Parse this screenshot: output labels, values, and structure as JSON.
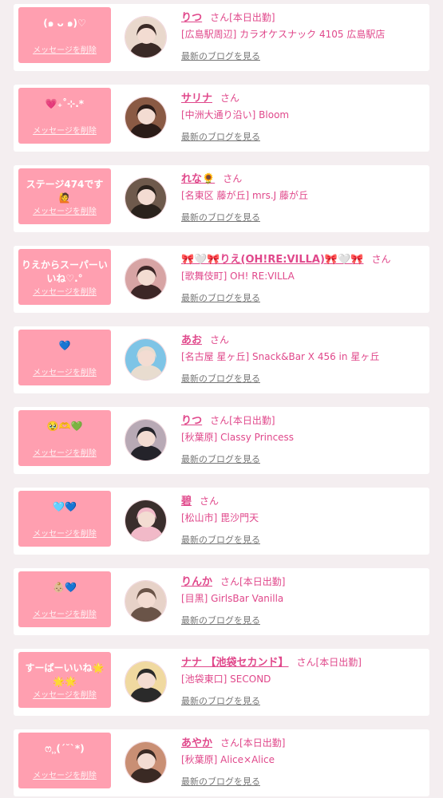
{
  "delete_label": "メッセージを削除",
  "blog_label": "最新のブログを見る",
  "honorific": "さん",
  "items": [
    {
      "message": "(๑ ᴗ ๑)♡",
      "name": "りつ",
      "status": "[本日出勤]",
      "shop": "[広島駅周辺] カラオケスナック 4105 広島駅店",
      "avatar_colors": [
        "#e9d8cc",
        "#3a2a26"
      ]
    },
    {
      "message": "💗₊˚⊹.*",
      "name": "サリナ",
      "status": "",
      "shop": "[中洲大通り沿い] Bloom",
      "avatar_colors": [
        "#8a5a44",
        "#2b1c18"
      ]
    },
    {
      "message": "ステージ474です🙋",
      "name": "れな🌻",
      "status": "",
      "shop": "[名東区 藤が丘] mrs.J 藤が丘",
      "avatar_colors": [
        "#6e5a4c",
        "#2a221c"
      ]
    },
    {
      "message": "りえからスーパーいいね♡.°",
      "name": "🎀🤍🎀りえ(OH!RE:VILLA)🎀🤍🎀",
      "status": "",
      "shop": "[歌舞伎町] OH! RE:VILLA",
      "avatar_colors": [
        "#d7a4a4",
        "#3c2626"
      ]
    },
    {
      "message": "💙",
      "name": "あお",
      "status": "",
      "shop": "[名古屋 星ヶ丘] Snack&Bar X 456 in 星ヶ丘",
      "avatar_colors": [
        "#7ec4e6",
        "#e8dccf"
      ]
    },
    {
      "message": "🥹🫶💚",
      "name": "りつ",
      "status": "[本日出勤]",
      "shop": "[秋葉原] Classy Princess",
      "avatar_colors": [
        "#b8a9b5",
        "#24232a"
      ]
    },
    {
      "message": "🩵💙",
      "name": "碧",
      "status": "",
      "shop": "[松山市] 毘沙門天",
      "avatar_colors": [
        "#3a2e2c",
        "#f1b9c8"
      ]
    },
    {
      "message": "👶🏼💙",
      "name": "りんか",
      "status": "[本日出勤]",
      "shop": "[目黒] GirlsBar Vanilla",
      "avatar_colors": [
        "#e7d2c8",
        "#6a5448"
      ]
    },
    {
      "message": "すーぱーいいね🌟🌟🌟",
      "name": "ナナ 【池袋セカンド】",
      "status": "[本日出勤]",
      "shop": "[池袋東口] SECOND",
      "avatar_colors": [
        "#f0d9a0",
        "#2a2a2a"
      ]
    },
    {
      "message": "ෆ⸒⸒(´˘`*)",
      "name": "あやか",
      "status": "[本日出勤]",
      "shop": "[秋葉原] Alice×Alice",
      "avatar_colors": [
        "#c98f74",
        "#3a2a24"
      ]
    }
  ]
}
